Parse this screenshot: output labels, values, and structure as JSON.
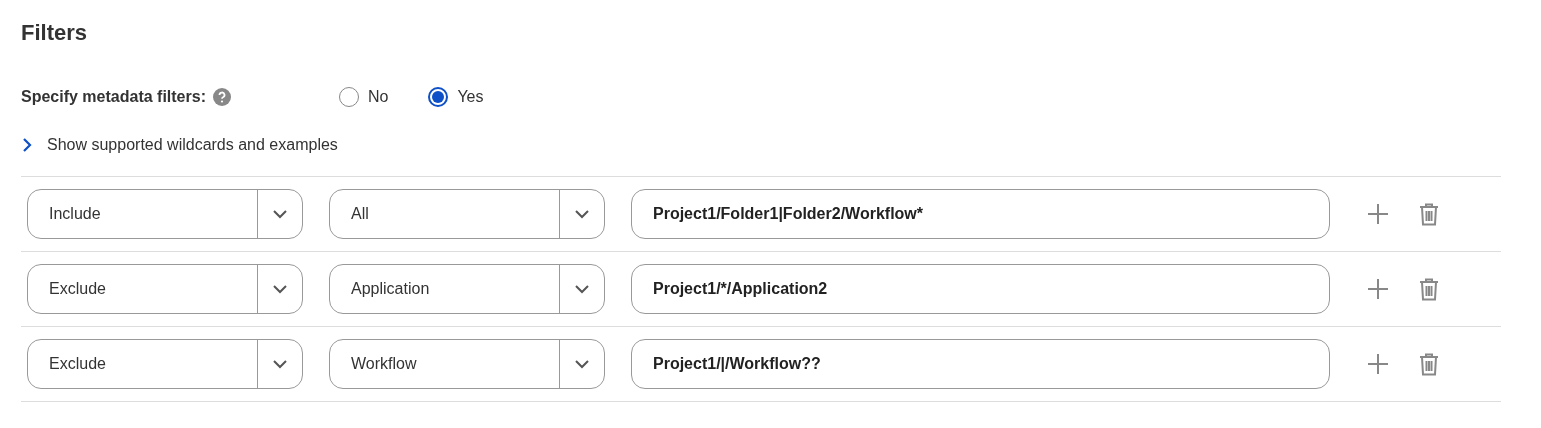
{
  "title": "Filters",
  "metadata_filters": {
    "label": "Specify metadata filters:",
    "options": [
      {
        "label": "No",
        "selected": false
      },
      {
        "label": "Yes",
        "selected": true
      }
    ]
  },
  "wildcards_toggle": {
    "label": "Show supported wildcards and examples",
    "expanded": false
  },
  "rules": [
    {
      "mode": "Include",
      "type": "All",
      "path": "Project1/Folder1|Folder2/Workflow*"
    },
    {
      "mode": "Exclude",
      "type": "Application",
      "path": "Project1/*/Application2"
    },
    {
      "mode": "Exclude",
      "type": "Workflow",
      "path": "Project1/|/Workflow??"
    }
  ]
}
